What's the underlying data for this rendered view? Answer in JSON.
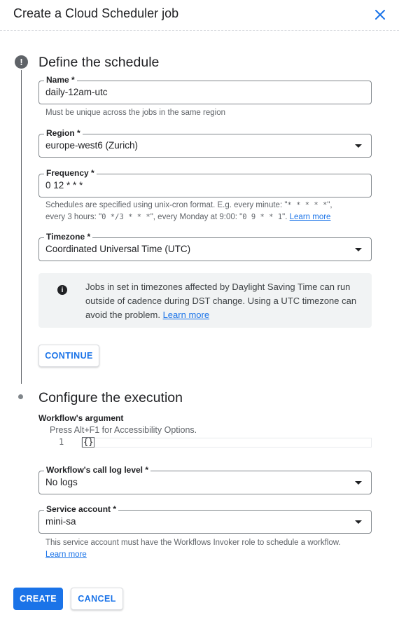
{
  "header": {
    "title": "Create a Cloud Scheduler job",
    "close_icon": "close-icon",
    "accent": "#1a73e8"
  },
  "step1": {
    "title": "Define the schedule",
    "status_icon": "alert-circle-icon",
    "name": {
      "label": "Name *",
      "value": "daily-12am-utc",
      "hint": "Must be unique across the jobs in the same region"
    },
    "region": {
      "label": "Region *",
      "value": "europe-west6 (Zurich)"
    },
    "frequency": {
      "label": "Frequency *",
      "value": "0 12 * * *",
      "hint_l1": "Schedules are specified using unix-cron format. E.g. every minute: \"",
      "hint_l1_code": "* * * * *",
      "hint_l1_end": "\",",
      "hint_l2a": "every 3 hours: \"",
      "hint_l2_code1": "0 */3 * * *",
      "hint_l2b": "\", every Monday at 9:00: \"",
      "hint_l2_code2": "0 9 * * 1",
      "hint_l2c": "\". ",
      "learn_more": "Learn more"
    },
    "timezone": {
      "label": "Timezone *",
      "value": "Coordinated Universal Time (UTC)"
    },
    "info": {
      "icon": "info-icon",
      "text": "Jobs in set in timezones affected by Daylight Saving Time can run outside of cadence during DST change. Using a UTC timezone can avoid the problem.",
      "learn_more": "Learn more"
    },
    "continue_label": "CONTINUE"
  },
  "step2": {
    "title": "Configure the execution",
    "argument": {
      "label": "Workflow's argument",
      "note": "Press Alt+F1 for Accessibility Options.",
      "line_number": "1",
      "code": "{}"
    },
    "log_level": {
      "label": "Workflow's call log level *",
      "value": "No logs"
    },
    "service_account": {
      "label": "Service account *",
      "value": "mini-sa",
      "hint": "This service account must have the Workflows Invoker role to schedule a workflow.",
      "learn_more": "Learn more"
    }
  },
  "footer": {
    "create_label": "CREATE",
    "cancel_label": "CANCEL"
  }
}
